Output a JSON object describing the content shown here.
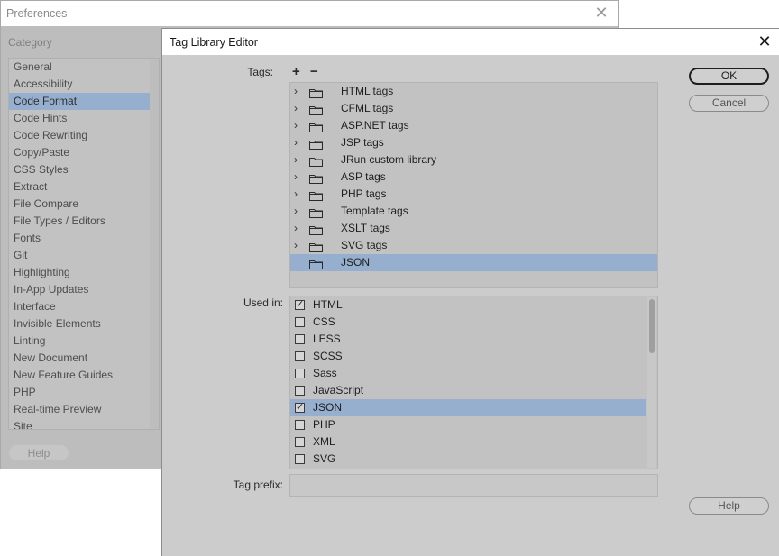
{
  "prefs": {
    "title": "Preferences",
    "category_label": "Category",
    "categories": [
      {
        "label": "General",
        "selected": false
      },
      {
        "label": "Accessibility",
        "selected": false
      },
      {
        "label": "Code Format",
        "selected": true
      },
      {
        "label": "Code Hints",
        "selected": false
      },
      {
        "label": "Code Rewriting",
        "selected": false
      },
      {
        "label": "Copy/Paste",
        "selected": false
      },
      {
        "label": "CSS Styles",
        "selected": false
      },
      {
        "label": "Extract",
        "selected": false
      },
      {
        "label": "File Compare",
        "selected": false
      },
      {
        "label": "File Types / Editors",
        "selected": false
      },
      {
        "label": "Fonts",
        "selected": false
      },
      {
        "label": "Git",
        "selected": false
      },
      {
        "label": "Highlighting",
        "selected": false
      },
      {
        "label": "In-App Updates",
        "selected": false
      },
      {
        "label": "Interface",
        "selected": false
      },
      {
        "label": "Invisible Elements",
        "selected": false
      },
      {
        "label": "Linting",
        "selected": false
      },
      {
        "label": "New Document",
        "selected": false
      },
      {
        "label": "New Feature Guides",
        "selected": false
      },
      {
        "label": "PHP",
        "selected": false
      },
      {
        "label": "Real-time Preview",
        "selected": false
      },
      {
        "label": "Site",
        "selected": false
      }
    ],
    "help_label": "Help"
  },
  "editor": {
    "title": "Tag Library Editor",
    "tags_label": "Tags:",
    "add_icon": "plus-icon",
    "remove_icon": "minus-icon",
    "tags": [
      {
        "label": "HTML tags",
        "expandable": true,
        "selected": false
      },
      {
        "label": "CFML tags",
        "expandable": true,
        "selected": false
      },
      {
        "label": "ASP.NET tags",
        "expandable": true,
        "selected": false
      },
      {
        "label": "JSP tags",
        "expandable": true,
        "selected": false
      },
      {
        "label": "JRun custom library",
        "expandable": true,
        "selected": false
      },
      {
        "label": "ASP tags",
        "expandable": true,
        "selected": false
      },
      {
        "label": "PHP tags",
        "expandable": true,
        "selected": false
      },
      {
        "label": "Template tags",
        "expandable": true,
        "selected": false
      },
      {
        "label": "XSLT tags",
        "expandable": true,
        "selected": false
      },
      {
        "label": "SVG tags",
        "expandable": true,
        "selected": false
      },
      {
        "label": "JSON",
        "expandable": false,
        "selected": true
      }
    ],
    "used_in_label": "Used in:",
    "used_in": [
      {
        "label": "HTML",
        "checked": true,
        "selected": false
      },
      {
        "label": "CSS",
        "checked": false,
        "selected": false
      },
      {
        "label": "LESS",
        "checked": false,
        "selected": false
      },
      {
        "label": "SCSS",
        "checked": false,
        "selected": false
      },
      {
        "label": "Sass",
        "checked": false,
        "selected": false
      },
      {
        "label": "JavaScript",
        "checked": false,
        "selected": false
      },
      {
        "label": "JSON",
        "checked": true,
        "selected": true
      },
      {
        "label": "PHP",
        "checked": false,
        "selected": false
      },
      {
        "label": "XML",
        "checked": false,
        "selected": false
      },
      {
        "label": "SVG",
        "checked": false,
        "selected": false
      }
    ],
    "tag_prefix_label": "Tag prefix:",
    "tag_prefix_value": "",
    "ok_label": "OK",
    "cancel_label": "Cancel",
    "help_label": "Help"
  },
  "colors": {
    "selection": "#97afce",
    "dialog_bg": "#cccccc",
    "list_bg": "#c2c2c2"
  }
}
